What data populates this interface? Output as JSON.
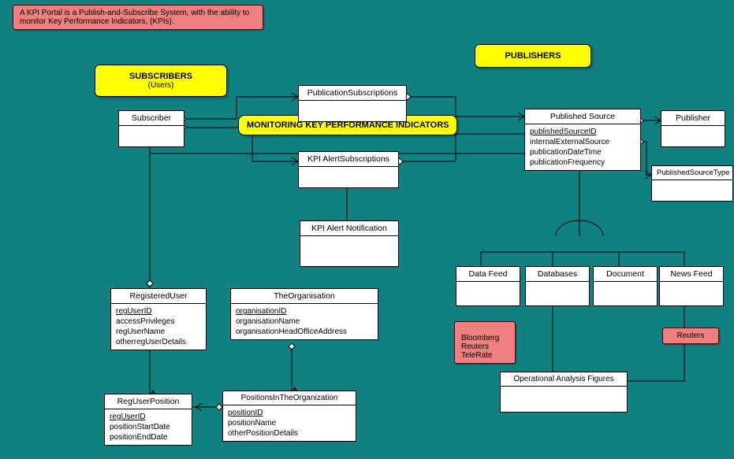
{
  "note": {
    "description": "A KPI Portal is a Publish-and-Subscribe System, with the ability to monitor Key Performance Indicators, (KPIs)."
  },
  "labels": {
    "subscribers_title": "SUBSCRIBERS",
    "subscribers_sub": "(Users)",
    "publishers": "PUBLISHERS",
    "monitoring": "MONITORING KEY PERFORMANCE INDICATORS"
  },
  "providers": {
    "left": "Bloomberg\nReuters\nTeleRate",
    "right": "Reuters"
  },
  "entities": {
    "subscriber": {
      "name": "Subscriber",
      "attrs": []
    },
    "publicationSubscriptions": {
      "name": "PublicationSubscriptions",
      "attrs": []
    },
    "kpiAlertSubscriptions": {
      "name": "KPI AlertSubscriptions",
      "attrs": []
    },
    "kpiAlertNotification": {
      "name": "KPI Alert Notification",
      "attrs": []
    },
    "publishedSource": {
      "name": "Published Source",
      "attrs": [
        {
          "text": "publishedSourceID",
          "pk": true
        },
        {
          "text": "internalExternalSource"
        },
        {
          "text": "publicationDateTime"
        },
        {
          "text": "publicationFrequency"
        }
      ]
    },
    "publisher": {
      "name": "Publisher",
      "attrs": []
    },
    "publishedSourceType": {
      "name": "PublishedSourceType",
      "attrs": []
    },
    "dataFeed": {
      "name": "Data Feed",
      "attrs": []
    },
    "databases": {
      "name": "Databases",
      "attrs": []
    },
    "document": {
      "name": "Document",
      "attrs": []
    },
    "newsFeed": {
      "name": "News Feed",
      "attrs": []
    },
    "operationalAnalysisFigures": {
      "name": "Operational Analysis Figures",
      "attrs": []
    },
    "registeredUser": {
      "name": "RegisteredUser",
      "attrs": [
        {
          "text": "regUserID",
          "pk": true
        },
        {
          "text": "accessPrivileges"
        },
        {
          "text": "regUserName"
        },
        {
          "text": "otherregUserDetails"
        }
      ]
    },
    "theOrganisation": {
      "name": "TheOrganisation",
      "attrs": [
        {
          "text": "organisationID",
          "pk": true
        },
        {
          "text": "organisationName"
        },
        {
          "text": "organisationHeadOfficeAddress"
        }
      ]
    },
    "regUserPosition": {
      "name": "RegUserPosition",
      "attrs": [
        {
          "text": "regUserID",
          "pk": true
        },
        {
          "text": "positionStartDate"
        },
        {
          "text": "positionEndDate"
        }
      ]
    },
    "positionsInTheOrganization": {
      "name": "PositionsInTheOrganization",
      "attrs": [
        {
          "text": "positionID",
          "pk": true
        },
        {
          "text": "positionName"
        },
        {
          "text": "otherPositionDetails"
        }
      ]
    }
  }
}
